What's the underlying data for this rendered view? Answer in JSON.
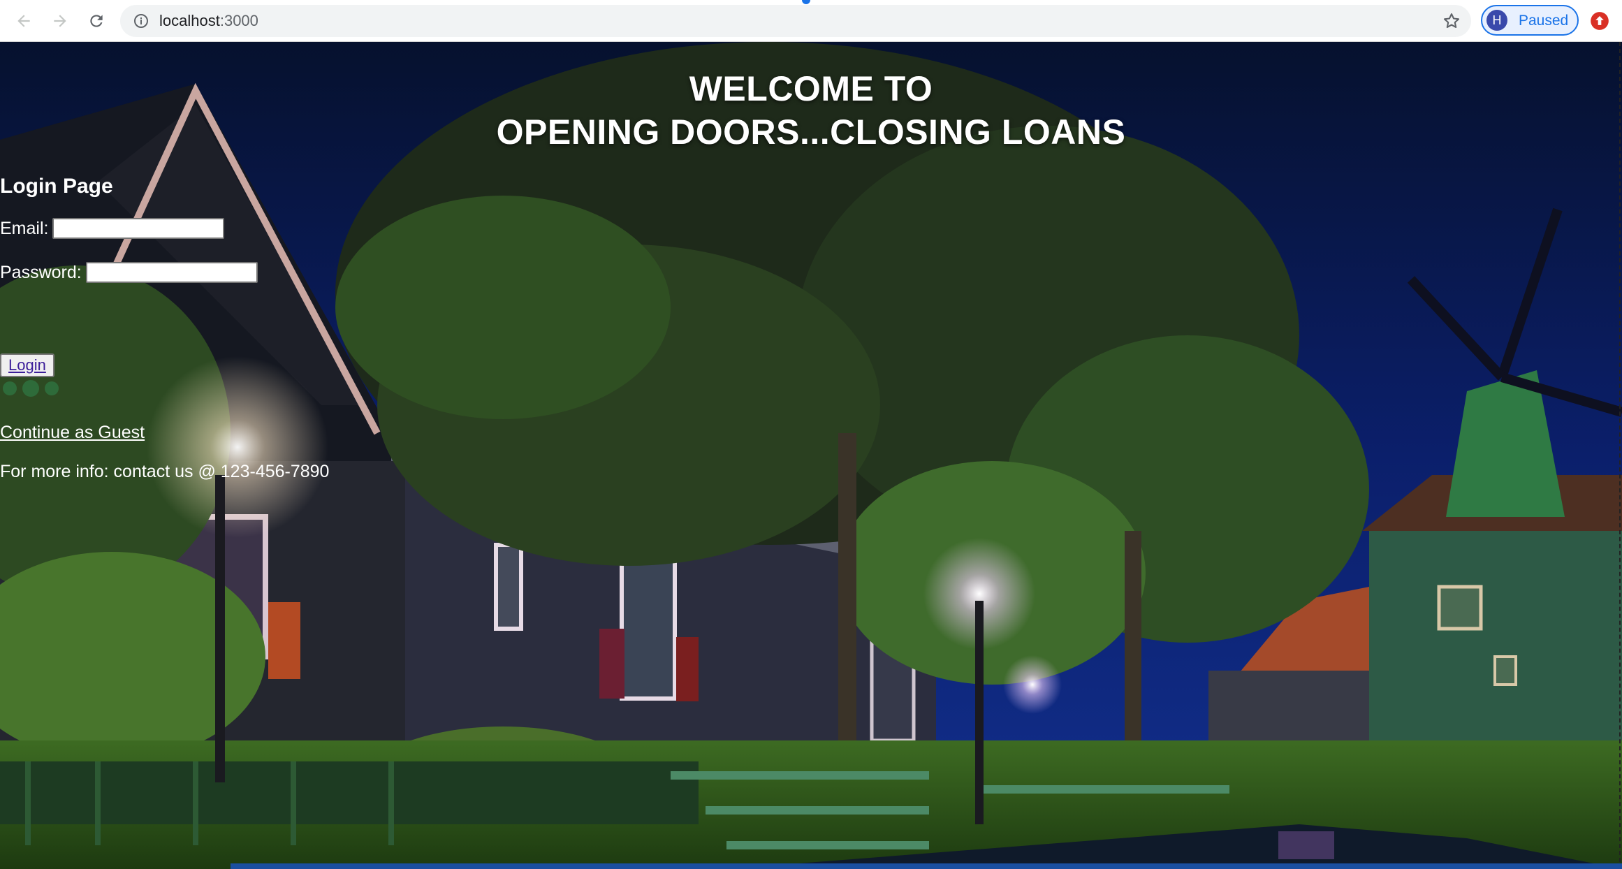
{
  "browser": {
    "url_host": "localhost",
    "url_port": ":3000",
    "profile_initial": "H",
    "profile_status": "Paused"
  },
  "hero": {
    "line1": "WELCOME TO",
    "line2": "OPENING DOORS...CLOSING LOANS"
  },
  "login": {
    "title": "Login Page",
    "email_label": "Email:",
    "email_value": "",
    "password_label": "Password:",
    "password_value": "",
    "button_label": "Login",
    "guest_link": "Continue as Guest",
    "info_text": "For more info: contact us @ 123-456-7890"
  },
  "colors": {
    "link_color": "#3b1e99",
    "loader_color": "#2e6b3a",
    "chrome_accent": "#1a73e8"
  },
  "icons": [
    "back-arrow-icon",
    "forward-arrow-icon",
    "reload-icon",
    "info-icon",
    "star-icon",
    "update-icon",
    "loader-dots-icon"
  ]
}
